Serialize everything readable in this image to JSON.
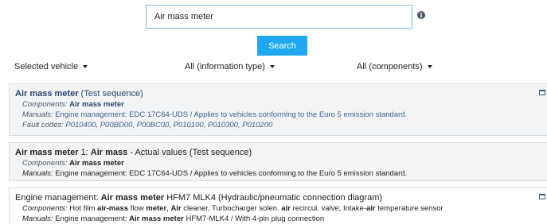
{
  "search": {
    "value": "Air mass meter"
  },
  "search_button": "Search",
  "filters": {
    "vehicle": "Selected vehicle",
    "info_type": "All (information type)",
    "components": "All (components)"
  },
  "results": [
    {
      "title_bold": "Air mass meter",
      "title_rest": " (Test sequence)",
      "components_label": "Components:",
      "components_value": "Air mass meter",
      "manuals_label": "Manuals:",
      "manuals_value": "Engine management: EDC 17C64-UDS / Applies to vehicles conforming to the Euro 5 emission standard.",
      "fault_label": "Fault codes:",
      "fault_value": "P010400, P00BD00, P00BC00, P010100, P010300, P010200"
    },
    {
      "title_bold_1": "Air mass meter",
      "title_mid": " 1: ",
      "title_bold_2": "Air mass",
      "title_rest": " - Actual values (Test sequence)",
      "components_label": "Components:",
      "components_value": "Air mass meter",
      "manuals_label": "Manuals:",
      "manuals_value": "Engine management: EDC 17C64-UDS / Applies to vehicles conforming to the Euro 5 emission standard."
    },
    {
      "title_pre": "Engine management: ",
      "title_bold": "Air mass meter",
      "title_rest": " HFM7 MLK4 (Hydraulic/pneumatic connection diagram)",
      "components_label": "Components:",
      "comp_1": " Hot film ",
      "comp_2": "air-mass",
      "comp_3": " flow ",
      "comp_4": "meter",
      "comp_5": ", ",
      "comp_6": "Air",
      "comp_7": " cleaner, Turbocharger solen. ",
      "comp_8": "air",
      "comp_9": " recircul. valve, Intake-",
      "comp_10": "air",
      "comp_11": " temperature sensor",
      "manuals_label": "Manuals:",
      "man_1": " Engine management: ",
      "man_2": "Air mass meter",
      "man_3": " HFM7-MLK4 / With 4-pin plug connection"
    }
  ]
}
